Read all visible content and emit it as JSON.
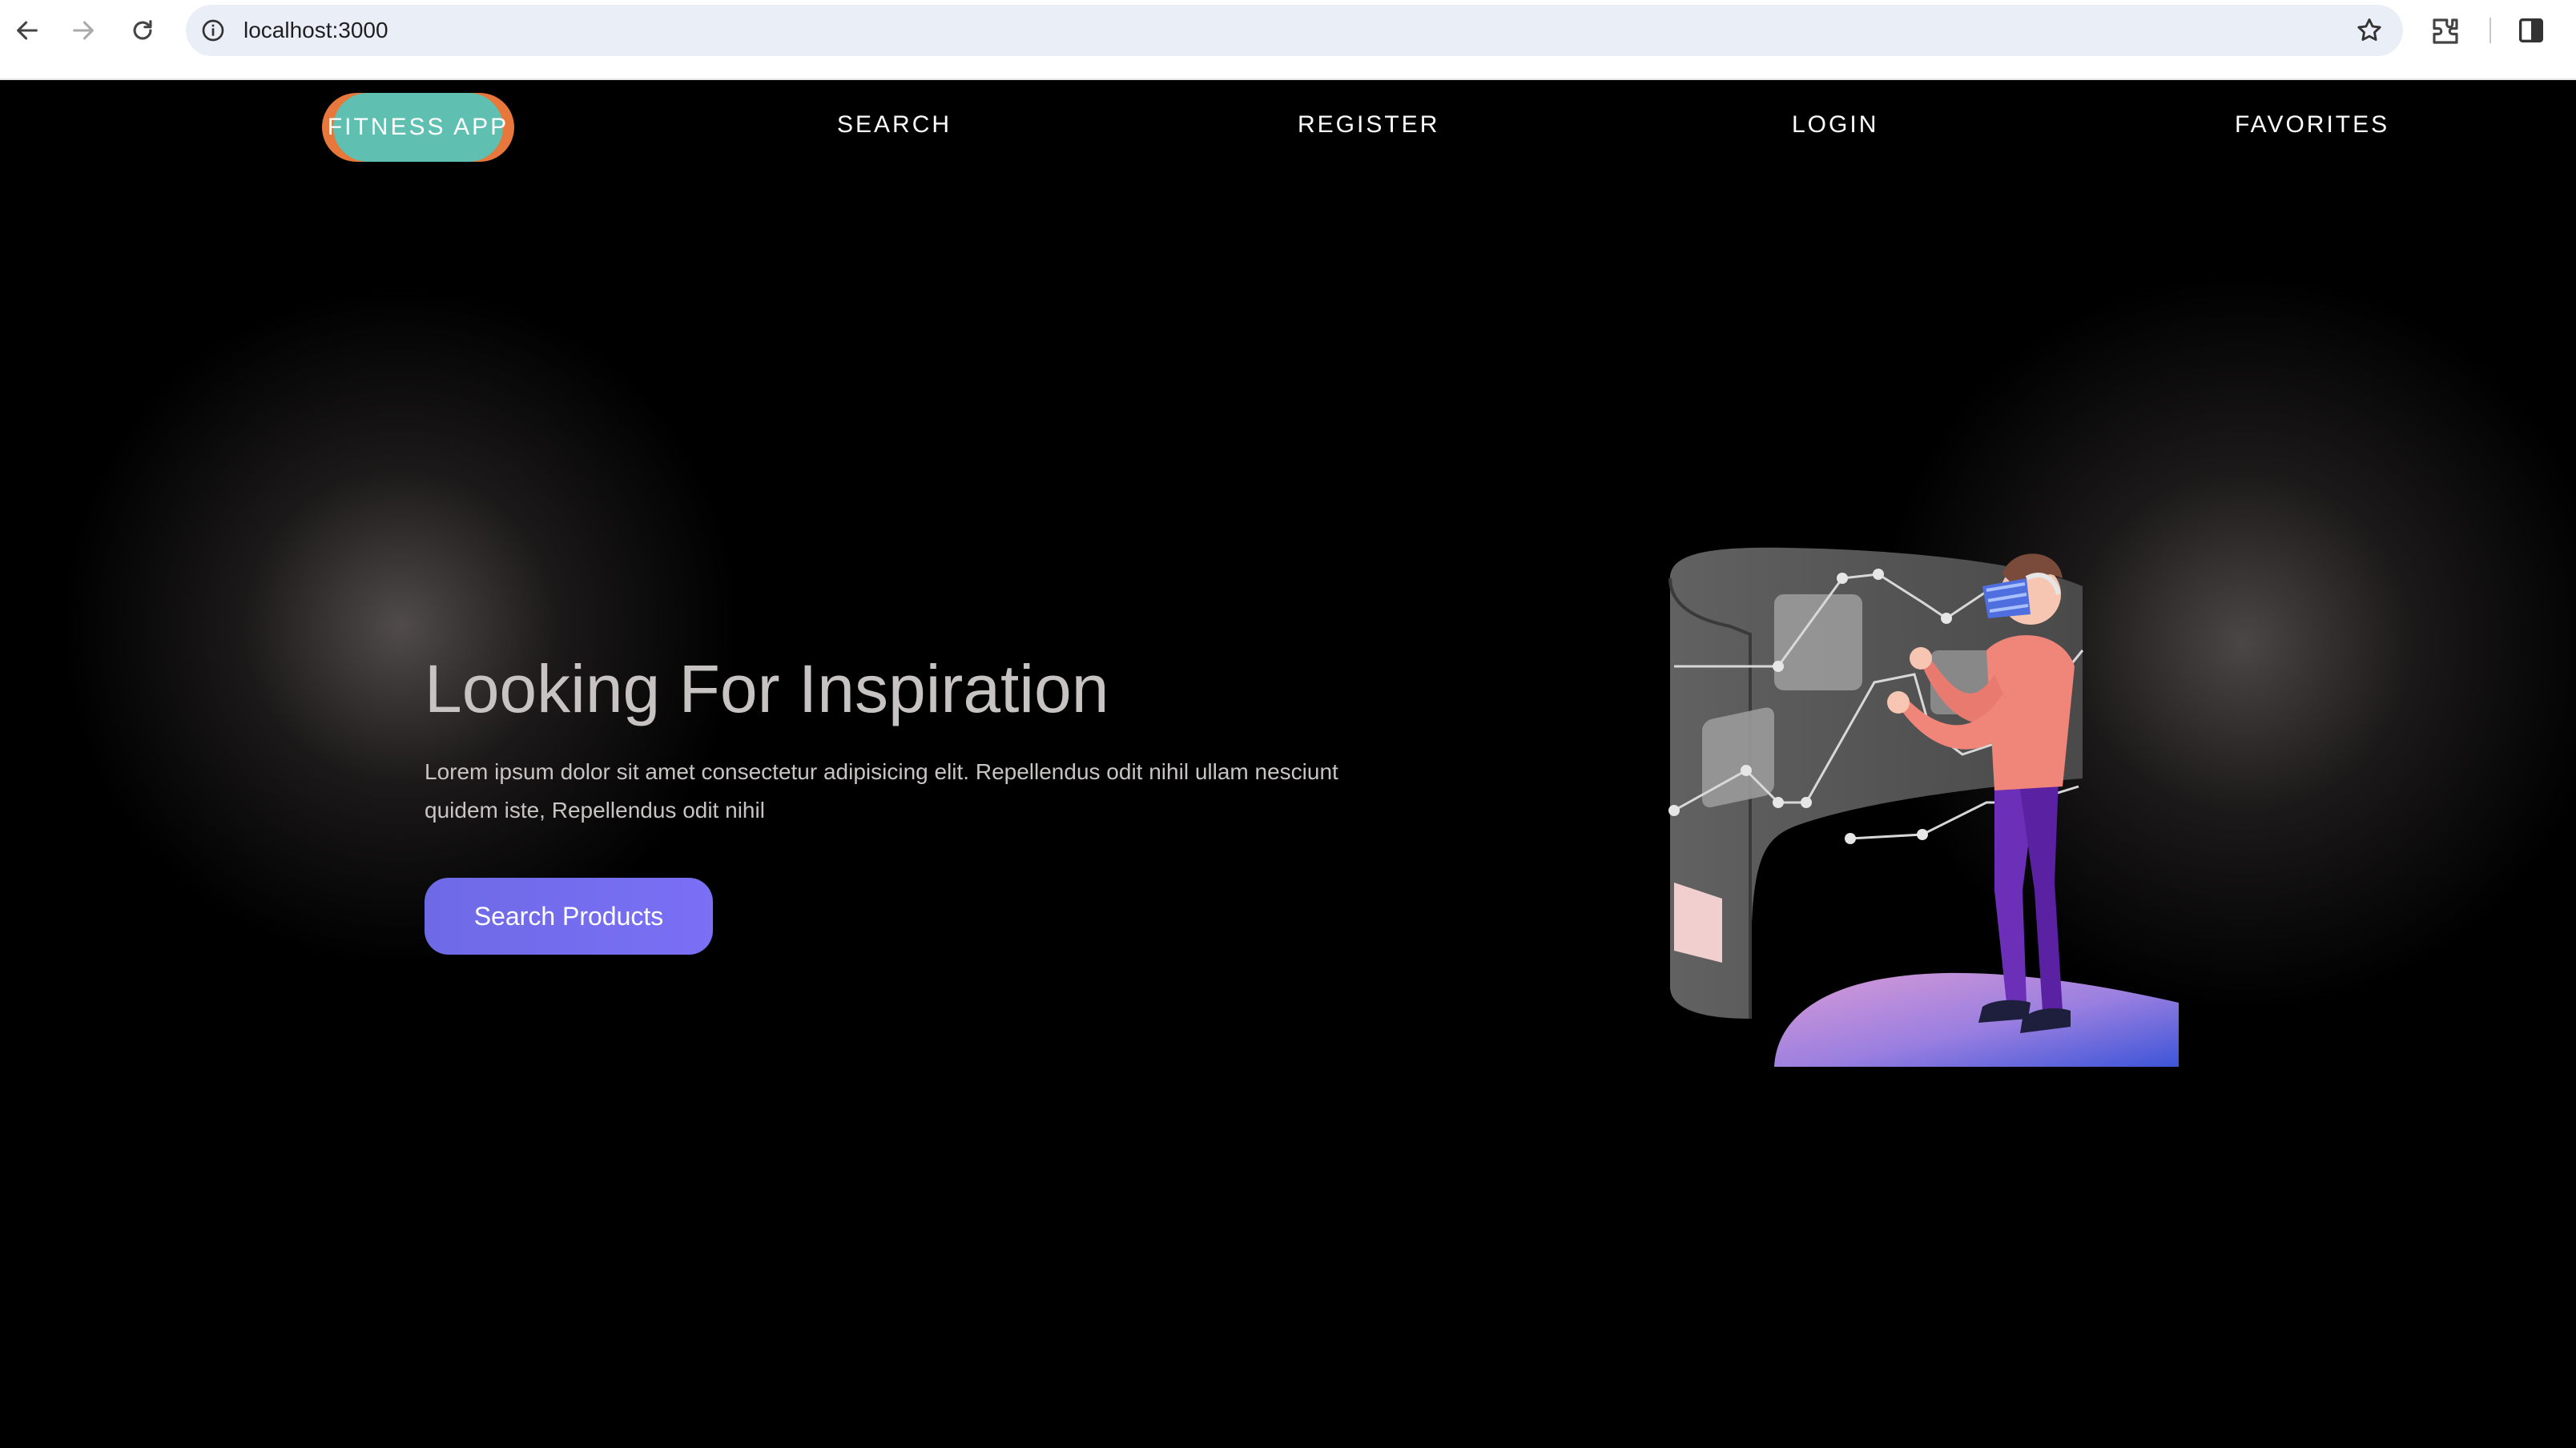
{
  "browser": {
    "url": "localhost:3000"
  },
  "nav": {
    "brand": "FITNESS APP",
    "links": [
      {
        "label": "SEARCH"
      },
      {
        "label": "REGISTER"
      },
      {
        "label": "LOGIN"
      },
      {
        "label": "FAVORITES"
      }
    ]
  },
  "hero": {
    "title": "Looking For Inspiration",
    "text": "Lorem ipsum dolor sit amet consectetur adipisicing elit. Repellendus odit nihil ullam nesciunt quidem iste, Repellendus odit nihil",
    "cta_label": "Search Products"
  },
  "colors": {
    "brand_teal": "#5fbfb0",
    "brand_orange": "#e8773b",
    "cta": "#7a6ff5",
    "background": "#000000"
  },
  "icons": [
    "back-arrow-icon",
    "forward-arrow-icon",
    "reload-icon",
    "info-icon",
    "star-icon",
    "extensions-icon",
    "side-panel-icon"
  ]
}
